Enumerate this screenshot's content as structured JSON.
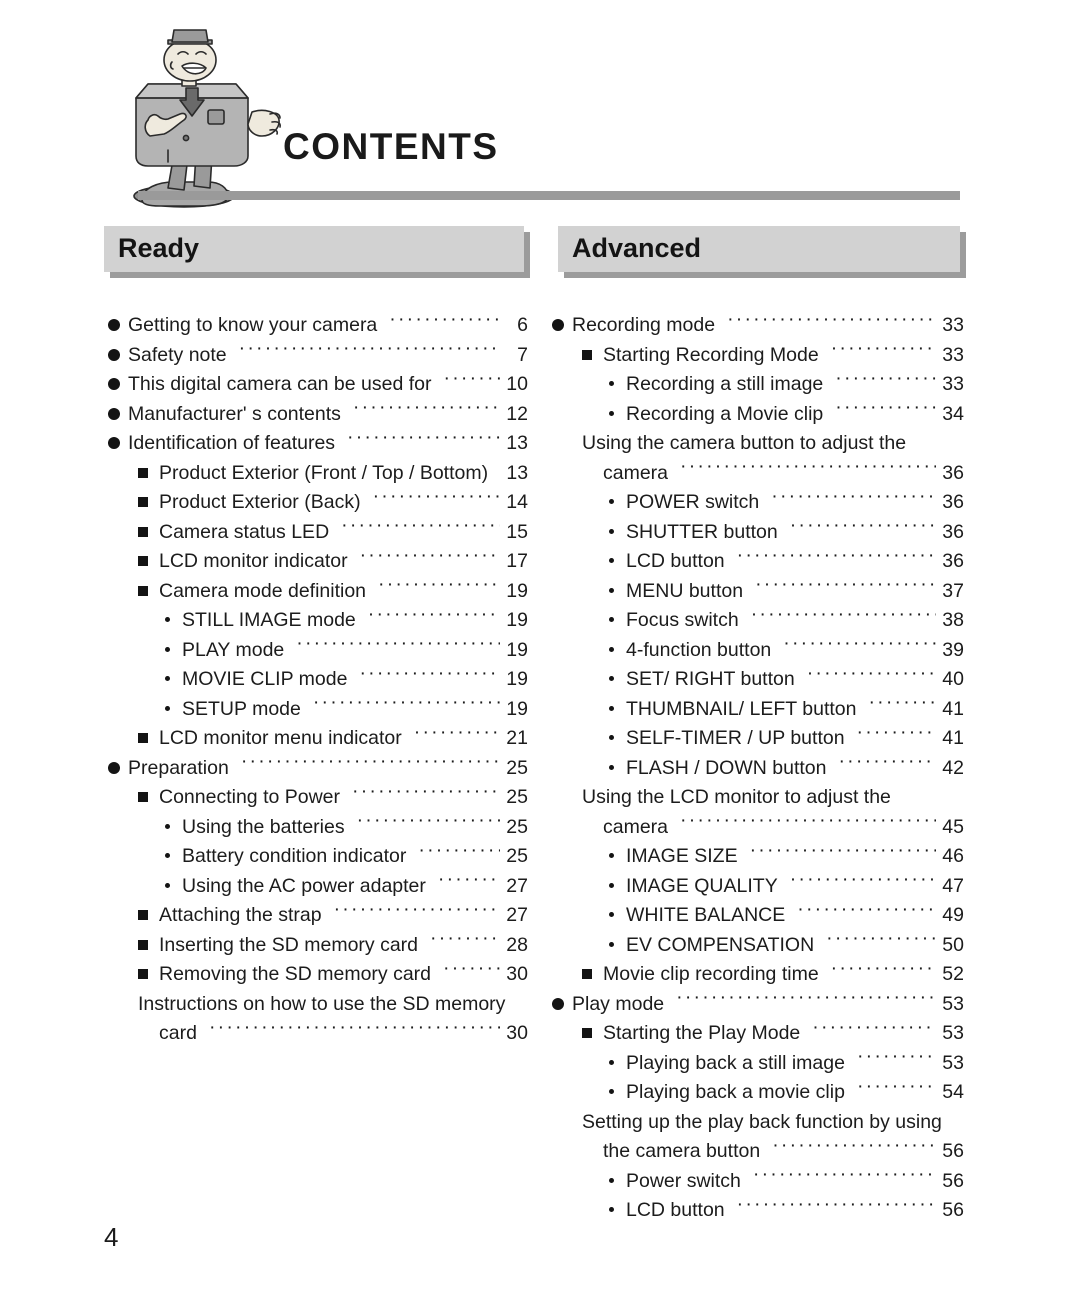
{
  "page": {
    "title": "CONTENTS",
    "folio": "4",
    "mascot_icon": "camera-mascot-illustration"
  },
  "sections": [
    {
      "id": "ready",
      "heading": "Ready",
      "entries": [
        {
          "level": 1,
          "text": "Getting to know your camera",
          "page": "6"
        },
        {
          "level": 1,
          "text": "Safety note",
          "page": "7"
        },
        {
          "level": 1,
          "text": "This digital camera can be used for",
          "page": "10"
        },
        {
          "level": 1,
          "text": "Manufacturer' s contents",
          "page": "12"
        },
        {
          "level": 1,
          "text": "Identification of features",
          "page": "13"
        },
        {
          "level": 2,
          "text": "Product Exterior (Front / Top / Bottom)",
          "page": "13"
        },
        {
          "level": 2,
          "text": "Product Exterior (Back)",
          "page": "14"
        },
        {
          "level": 2,
          "text": "Camera status LED",
          "page": "15"
        },
        {
          "level": 2,
          "text": "LCD monitor indicator",
          "page": "17"
        },
        {
          "level": 2,
          "text": "Camera mode definition",
          "page": "19"
        },
        {
          "level": 3,
          "text": "STILL IMAGE mode",
          "page": "19"
        },
        {
          "level": 3,
          "text": "PLAY mode",
          "page": "19"
        },
        {
          "level": 3,
          "text": "MOVIE CLIP mode",
          "page": "19"
        },
        {
          "level": 3,
          "text": "SETUP mode",
          "page": "19"
        },
        {
          "level": 2,
          "text": "LCD monitor menu indicator",
          "page": "21"
        },
        {
          "level": 1,
          "text": "Preparation",
          "page": "25"
        },
        {
          "level": 2,
          "text": "Connecting to Power",
          "page": "25"
        },
        {
          "level": 3,
          "text": "Using the batteries",
          "page": "25"
        },
        {
          "level": 3,
          "text": "Battery condition indicator",
          "page": "25"
        },
        {
          "level": 3,
          "text": "Using the AC power adapter",
          "page": "27"
        },
        {
          "level": 2,
          "text": "Attaching the strap",
          "page": "27"
        },
        {
          "level": 2,
          "text": "Inserting the SD memory card",
          "page": "28"
        },
        {
          "level": 2,
          "text": "Removing the SD memory card",
          "page": "30"
        },
        {
          "level": 2,
          "text": "Instructions on how to use the SD memory",
          "text2": "card",
          "page": "30"
        }
      ]
    },
    {
      "id": "advanced",
      "heading": "Advanced",
      "entries": [
        {
          "level": 1,
          "text": "Recording mode",
          "page": "33"
        },
        {
          "level": 2,
          "text": "Starting Recording Mode",
          "page": "33"
        },
        {
          "level": 3,
          "text": "Recording a still image",
          "page": "33"
        },
        {
          "level": 3,
          "text": "Recording a Movie clip",
          "page": "34"
        },
        {
          "level": 2,
          "text": "Using the camera button to adjust the",
          "text2": "camera",
          "page": "36"
        },
        {
          "level": 3,
          "text": "POWER switch",
          "page": "36"
        },
        {
          "level": 3,
          "text": "SHUTTER button",
          "page": "36"
        },
        {
          "level": 3,
          "text": "LCD button",
          "page": "36"
        },
        {
          "level": 3,
          "text": "MENU button",
          "page": "37"
        },
        {
          "level": 3,
          "text": "Focus switch",
          "page": "38"
        },
        {
          "level": 3,
          "text": "4-function button",
          "page": "39"
        },
        {
          "level": 3,
          "text": "SET/ RIGHT button",
          "page": "40"
        },
        {
          "level": 3,
          "text": "THUMBNAIL/ LEFT button",
          "page": "41"
        },
        {
          "level": 3,
          "text": "SELF-TIMER / UP button",
          "page": "41"
        },
        {
          "level": 3,
          "text": "FLASH / DOWN button",
          "page": "42"
        },
        {
          "level": 2,
          "text": "Using the LCD monitor to adjust the",
          "text2": "camera",
          "page": "45"
        },
        {
          "level": 3,
          "text": "IMAGE SIZE",
          "page": "46"
        },
        {
          "level": 3,
          "text": "IMAGE QUALITY",
          "page": "47"
        },
        {
          "level": 3,
          "text": "WHITE BALANCE",
          "page": "49"
        },
        {
          "level": 3,
          "text": "EV COMPENSATION",
          "page": "50"
        },
        {
          "level": 2,
          "text": "Movie clip recording time",
          "page": "52"
        },
        {
          "level": 1,
          "text": "Play mode",
          "page": "53"
        },
        {
          "level": 2,
          "text": "Starting the Play Mode",
          "page": "53"
        },
        {
          "level": 3,
          "text": "Playing back a still image",
          "page": "53"
        },
        {
          "level": 3,
          "text": "Playing back a movie clip",
          "page": "54"
        },
        {
          "level": 2,
          "text": "Setting up the play back function by using",
          "text2": "the camera button",
          "page": "56"
        },
        {
          "level": 3,
          "text": "Power switch",
          "page": "56"
        },
        {
          "level": 3,
          "text": "LCD button",
          "page": "56"
        }
      ]
    }
  ],
  "colors": {
    "header_box": "#d2d2d2",
    "header_shadow": "#9c9c9c",
    "rule": "#9a9a9a",
    "text": "#1c1c1c"
  }
}
